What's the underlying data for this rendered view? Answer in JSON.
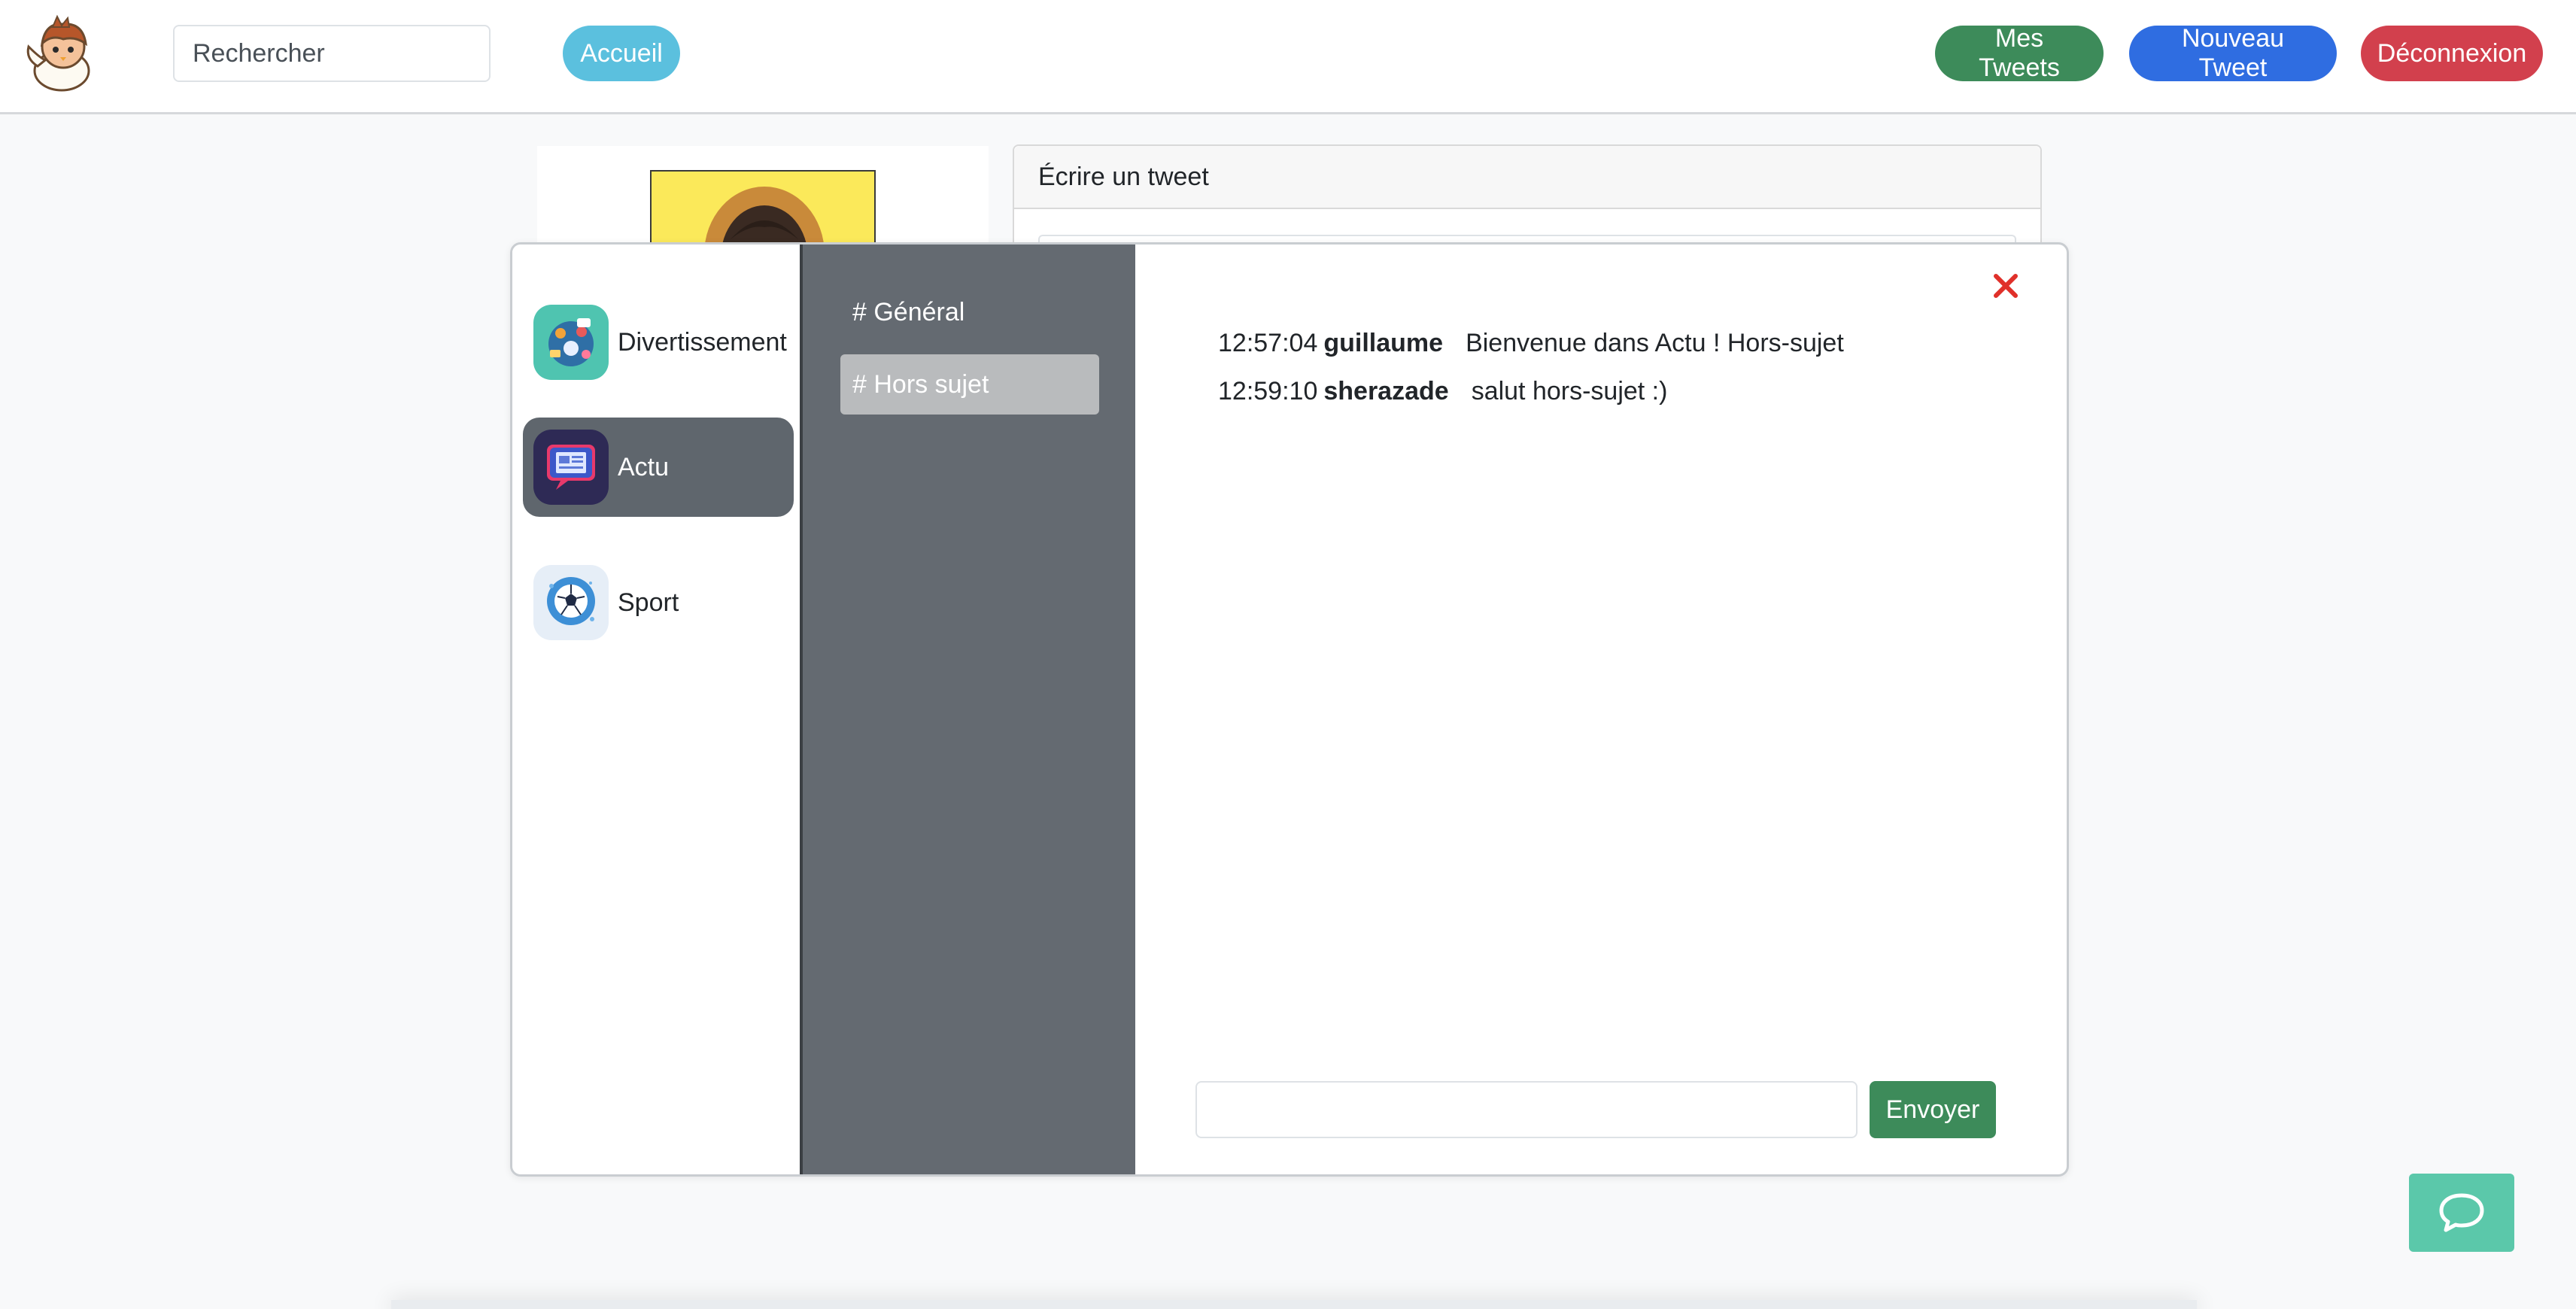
{
  "navbar": {
    "search_placeholder": "Rechercher",
    "home_label": "Accueil",
    "my_tweets_label": "Mes Tweets",
    "new_tweet_label": "Nouveau Tweet",
    "logout_label": "Déconnexion"
  },
  "page": {
    "compose_title": "Écrire un tweet"
  },
  "chat": {
    "servers": [
      {
        "name": "Divertissement",
        "icon": "entertainment-icon",
        "active": false
      },
      {
        "name": "Actu",
        "icon": "news-icon",
        "active": true
      },
      {
        "name": "Sport",
        "icon": "soccer-ball-icon",
        "active": false
      }
    ],
    "channels": [
      {
        "label": "# Général",
        "active": false
      },
      {
        "label": "# Hors sujet",
        "active": true
      }
    ],
    "messages": [
      {
        "time": "12:57:04",
        "author": "guillaume",
        "text": "Bienvenue dans Actu ! Hors-sujet"
      },
      {
        "time": "12:59:10",
        "author": "sherazade",
        "text": "salut hors-sujet :)"
      }
    ],
    "input_value": "",
    "send_label": "Envoyer"
  },
  "colors": {
    "success": "#3d8b5a",
    "primary": "#2f6de1",
    "danger": "#d2404d",
    "info": "#5bc0de",
    "channel_bg": "#646a71",
    "fab": "#5bc8aa"
  }
}
